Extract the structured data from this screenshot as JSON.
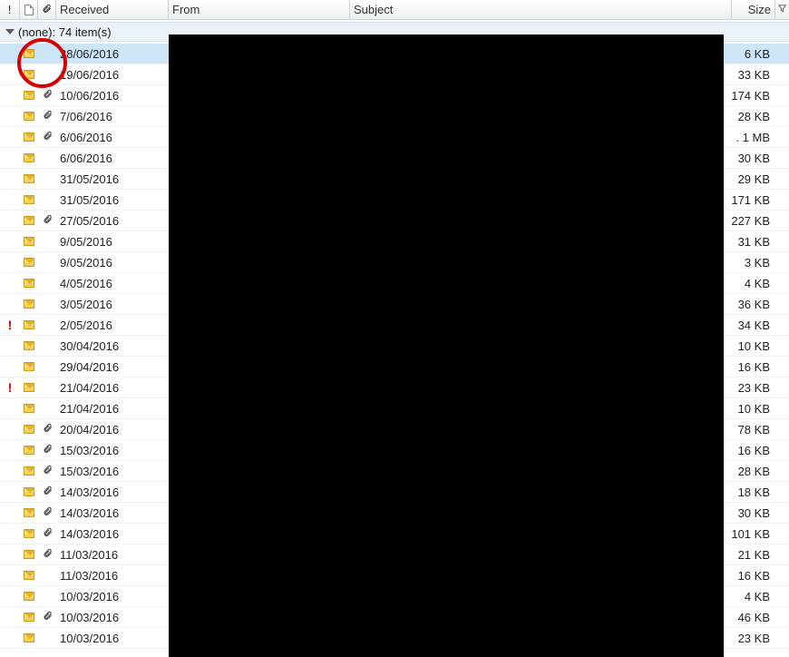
{
  "columns": {
    "importance": "!",
    "received": "Received",
    "from": "From",
    "subject": "Subject",
    "size": "Size"
  },
  "group": {
    "label": "(none): 74 item(s)"
  },
  "rows": [
    {
      "importance": "",
      "attach": false,
      "received": "28/06/2016",
      "size": "6 KB",
      "selected": true
    },
    {
      "importance": "",
      "attach": false,
      "received": "19/06/2016",
      "size": "33 KB"
    },
    {
      "importance": "",
      "attach": true,
      "received": "10/06/2016",
      "size": "174 KB"
    },
    {
      "importance": "",
      "attach": true,
      "received": "7/06/2016",
      "size": "28 KB"
    },
    {
      "importance": "",
      "attach": true,
      "received": "6/06/2016",
      "size": "1 MB",
      "prefix": "."
    },
    {
      "importance": "",
      "attach": false,
      "received": "6/06/2016",
      "size": "30 KB"
    },
    {
      "importance": "",
      "attach": false,
      "received": "31/05/2016",
      "size": "29 KB"
    },
    {
      "importance": "",
      "attach": false,
      "received": "31/05/2016",
      "size": "171 KB"
    },
    {
      "importance": "",
      "attach": true,
      "received": "27/05/2016",
      "size": "227 KB"
    },
    {
      "importance": "",
      "attach": false,
      "received": "9/05/2016",
      "size": "31 KB"
    },
    {
      "importance": "",
      "attach": false,
      "received": "9/05/2016",
      "size": "3 KB"
    },
    {
      "importance": "",
      "attach": false,
      "received": "4/05/2016",
      "size": "4 KB"
    },
    {
      "importance": "",
      "attach": false,
      "received": "3/05/2016",
      "size": "36 KB"
    },
    {
      "importance": "!",
      "attach": false,
      "received": "2/05/2016",
      "size": "34 KB"
    },
    {
      "importance": "",
      "attach": false,
      "received": "30/04/2016",
      "size": "10 KB"
    },
    {
      "importance": "",
      "attach": false,
      "received": "29/04/2016",
      "size": "16 KB"
    },
    {
      "importance": "!",
      "attach": false,
      "received": "21/04/2016",
      "size": "23 KB"
    },
    {
      "importance": "",
      "attach": false,
      "received": "21/04/2016",
      "size": "10 KB"
    },
    {
      "importance": "",
      "attach": true,
      "received": "20/04/2016",
      "size": "78 KB"
    },
    {
      "importance": "",
      "attach": true,
      "received": "15/03/2016",
      "size": "16 KB"
    },
    {
      "importance": "",
      "attach": true,
      "received": "15/03/2016",
      "size": "28 KB"
    },
    {
      "importance": "",
      "attach": true,
      "received": "14/03/2016",
      "size": "18 KB"
    },
    {
      "importance": "",
      "attach": true,
      "received": "14/03/2016",
      "size": "30 KB"
    },
    {
      "importance": "",
      "attach": true,
      "received": "14/03/2016",
      "size": "101 KB"
    },
    {
      "importance": "",
      "attach": true,
      "received": "11/03/2016",
      "size": "21 KB"
    },
    {
      "importance": "",
      "attach": false,
      "received": "11/03/2016",
      "size": "16 KB"
    },
    {
      "importance": "",
      "attach": false,
      "received": "10/03/2016",
      "size": "4 KB"
    },
    {
      "importance": "",
      "attach": true,
      "received": "10/03/2016",
      "size": "46 KB"
    },
    {
      "importance": "",
      "attach": false,
      "received": "10/03/2016",
      "size": "23 KB"
    }
  ]
}
